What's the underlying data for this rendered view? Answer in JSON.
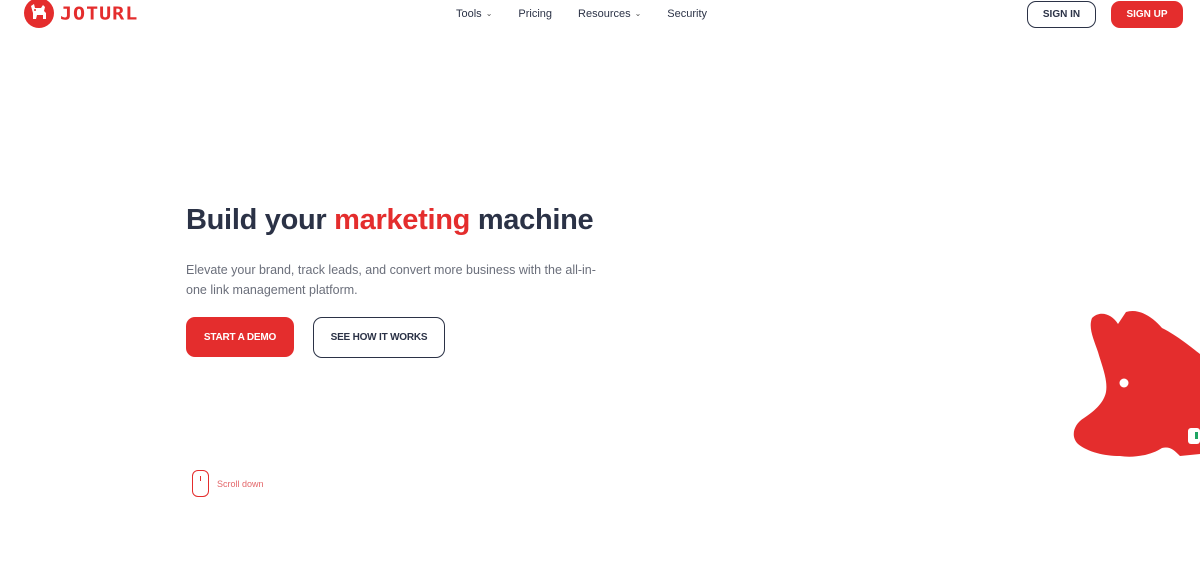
{
  "brand": {
    "name": "JOTURL",
    "accent_color": "#e42d2d",
    "text_color": "#2b3246"
  },
  "nav": {
    "items": [
      {
        "label": "Tools",
        "has_dropdown": true
      },
      {
        "label": "Pricing",
        "has_dropdown": false
      },
      {
        "label": "Resources",
        "has_dropdown": true
      },
      {
        "label": "Security",
        "has_dropdown": false
      }
    ],
    "chevron": "⌄"
  },
  "header": {
    "signin_label": "SIGN IN",
    "signup_label": "SIGN UP"
  },
  "hero": {
    "title_part1": "Build your ",
    "title_accent": "marketing",
    "title_part2": " machine",
    "subtitle": "Elevate your brand, track leads, and convert more business with the all-in-one link management platform.",
    "primary_cta": "START A DEMO",
    "secondary_cta": "SEE HOW IT WORKS"
  },
  "scroll": {
    "label": "Scroll down",
    "icon": "mouse-icon"
  },
  "decor": {
    "mascot_icon": "dog-mascot-icon"
  }
}
